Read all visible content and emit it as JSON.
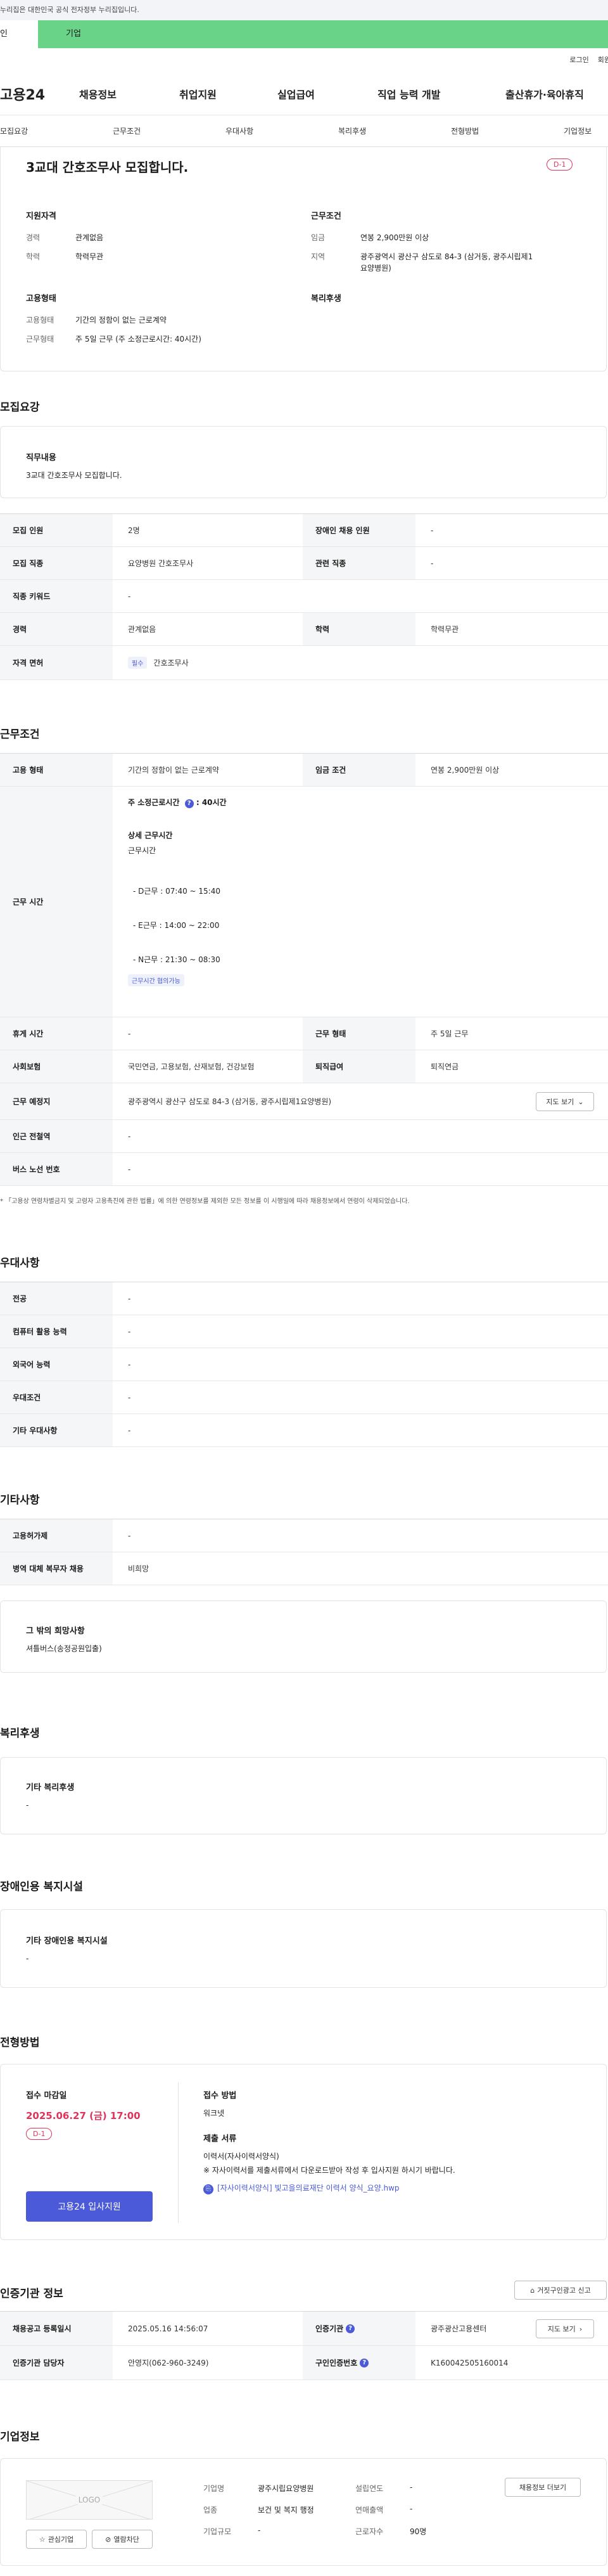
{
  "gov_banner": "누리집은 대한민국 공식 전자정부 누리집입니다.",
  "tabs": {
    "individual": "인",
    "company": "기업"
  },
  "util": {
    "login": "로그인",
    "signup": "회원"
  },
  "gnb": {
    "logo": "고용24",
    "items": [
      "채용정보",
      "취업지원",
      "실업급여",
      "직업 능력 개발",
      "출산휴가·육아휴직"
    ]
  },
  "subnav": [
    "모집요강",
    "근무조건",
    "우대사항",
    "복리후생",
    "전형방법",
    "기업정보"
  ],
  "summary": {
    "title": "3교대 간호조무사 모집합니다.",
    "dday": "D-1",
    "qual_title": "지원자격",
    "career_l": "경력",
    "career_v": "관계없음",
    "edu_l": "학력",
    "edu_v": "학력무관",
    "cond_title": "근무조건",
    "wage_l": "임금",
    "wage_v": "연봉 2,900만원 이상",
    "region_l": "지역",
    "region_v1": "광주광역시 광산구 삼도로 84-3 (삼거동, 광주시립제1",
    "region_v2": "요양병원)",
    "emp_title": "고용형태",
    "emp_type_l": "고용형태",
    "emp_type_v": "기간의 정함이 없는 근로계약",
    "work_form_l": "근무형태",
    "work_form_v": "주 5일 근무 (주 소정근로시간: 40시간)",
    "welfare_title": "복리후생"
  },
  "recruit": {
    "heading": "모집요강",
    "duty_title": "직무내용",
    "duty_text": "3교대 간호조무사 모집합니다.",
    "rows": {
      "headcount_l": "모집 인원",
      "headcount_v": "2명",
      "disabled_l": "장애인 채용 인원",
      "disabled_v": "-",
      "job_l": "모집 직종",
      "job_v": "요양병원 간호조무사",
      "related_l": "관련 직종",
      "related_v": "-",
      "keyword_l": "직종 키워드",
      "keyword_v": "-",
      "career_l": "경력",
      "career_v": "관계없음",
      "edu_l": "학력",
      "edu_v": "학력무관",
      "license_l": "자격 면허",
      "license_tag": "필수",
      "license_v": "간호조무사"
    }
  },
  "conditions": {
    "heading": "근무조건",
    "emp_l": "고용 형태",
    "emp_v": "기간의 정함이 없는 근로계약",
    "wage_l": "임금 조건",
    "wage_v": "연봉 2,900만원 이상",
    "hours_l": "근무 시간",
    "hours_main": "주 소정근로시간",
    "hours_main_v": ": 40시간",
    "detail_title": "상세 근무시간",
    "detail_sub": "근무시간",
    "shift_d": "- D근무 : 07:40 ~ 15:40",
    "shift_e": "- E근무 : 14:00 ~ 22:00",
    "shift_n": "- N근무 : 21:30 ~ 08:30",
    "flex_tag": "근무시간 협의가능",
    "rest_l": "휴게 시간",
    "rest_v": "-",
    "form_l": "근무 형태",
    "form_v": "주 5일 근무",
    "insurance_l": "사회보험",
    "insurance_v": "국민연금, 고용보험, 산재보험, 건강보험",
    "severance_l": "퇴직급여",
    "severance_v": "퇴직연금",
    "place_l": "근무 예정지",
    "place_v": "광주광역시 광산구 삼도로 84-3 (삼거동, 광주시립제1요양병원)",
    "map_btn": "지도 보기",
    "station_l": "인근 전철역",
    "station_v": "-",
    "bus_l": "버스 노선 번호",
    "bus_v": "-",
    "note": "* 「고용상 연령차별금지 및 고령자 고용촉진에 관한 법률」에 의한 연령정보를 제외한 모든 정보를 이 시행일에 따라 채용정보에서 연령이 삭제되었습니다."
  },
  "preference": {
    "heading": "우대사항",
    "major_l": "전공",
    "major_v": "-",
    "computer_l": "컴퓨터 활용 능력",
    "computer_v": "-",
    "lang_l": "외국어 능력",
    "lang_v": "-",
    "cond_l": "우대조건",
    "cond_v": "-",
    "etc_l": "기타 우대사항",
    "etc_v": "-"
  },
  "other": {
    "heading": "기타사항",
    "emp_type_l": "고용허가제",
    "emp_type_v": "-",
    "military_l": "병역 대체 복무자 채용",
    "military_v": "비희망",
    "wish_title": "그 밖의 희망사항",
    "wish_v": "셔틀버스(송정공원입출)"
  },
  "welfare": {
    "heading": "복리후생",
    "etc_title": "기타 복리후생",
    "etc_v": "-"
  },
  "disabled_fac": {
    "heading": "장애인용 복지시설",
    "etc_title": "기타 장애인용 복지시설",
    "etc_v": "-"
  },
  "selection": {
    "heading": "전형방법",
    "deadline_title": "접수 마감일",
    "deadline_v": "2025.06.27 (금) 17:00",
    "dday": "D-1",
    "apply_btn": "고용24 입사지원",
    "method_title": "접수 방법",
    "method_v": "워크넷",
    "docs_title": "제출 서류",
    "docs_v": "이력서(자사이력서양식)",
    "docs_note": "※ 자사이력서를 제출서류에서 다운로드받아 작성 후 입사지원 하시기 바랍니다.",
    "docs_file": "[자사이력서양식] 빛고을의료재단 이력서 양식_요양.hwp"
  },
  "agency": {
    "heading": "인증기관 정보",
    "report_btn": "거짓구인광고 신고",
    "reg_l": "채용공고 등록일시",
    "reg_v": "2025.05.16 14:56:07",
    "org_l": "인증기관",
    "org_v": "광주광산고용센터",
    "map_btn": "지도 보기",
    "contact_l": "인증기관 담당자",
    "contact_v": "안영지(062-960-3249)",
    "no_l": "구인인증번호",
    "no_v": "K160042505160014"
  },
  "company": {
    "heading": "기업정보",
    "logo_text": "LOGO",
    "fav_btn": "관심기업",
    "block_btn": "열람차단",
    "name_l": "기업명",
    "name_v": "광주시립요양병원",
    "year_l": "설립연도",
    "year_v": "-",
    "jobs_btn": "채용정보 더보기",
    "industry_l": "업종",
    "industry_v": "보건 및 복지 행정",
    "sales_l": "연매출액",
    "sales_v": "-",
    "size_l": "기업규모",
    "size_v": "-",
    "emp_l": "근로자수",
    "emp_v": "90명"
  },
  "colors": {
    "accent": "#69d387",
    "dday": "#e0335a",
    "button": "#4a5ad8"
  }
}
